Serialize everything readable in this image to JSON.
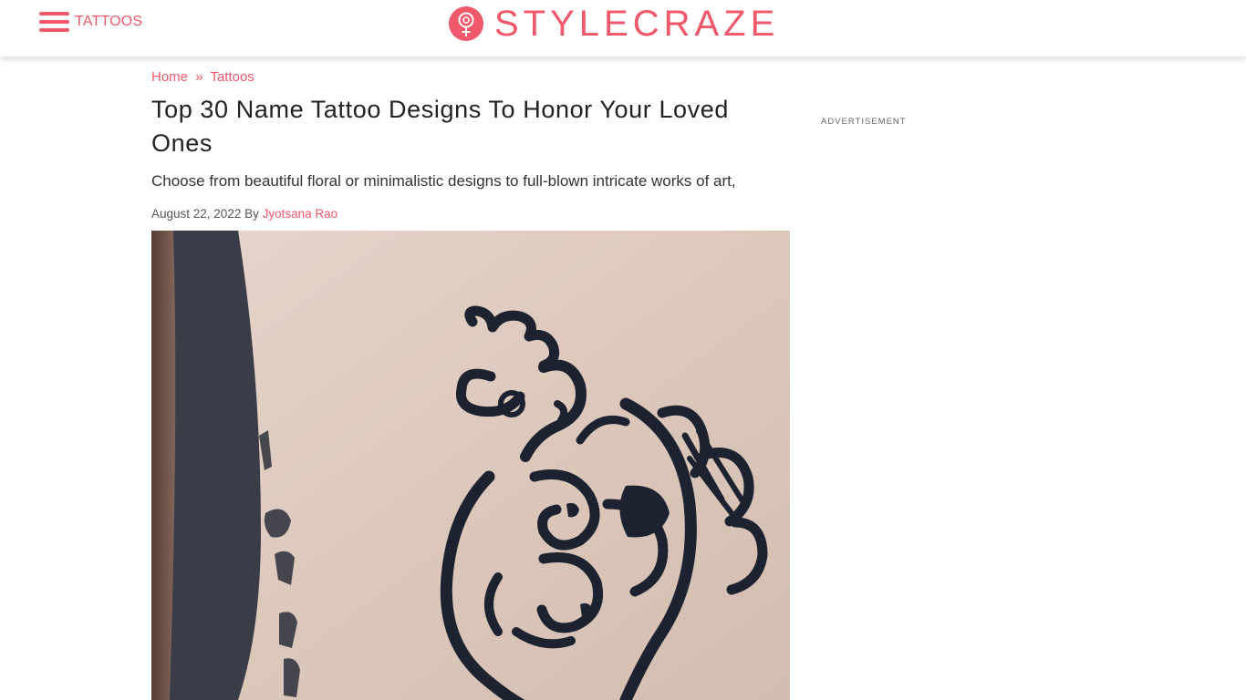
{
  "header": {
    "menu_label": "TATTOOS",
    "logo_text": "STYLECRAZE",
    "brand_color": "#f0586b"
  },
  "breadcrumb": {
    "home": "Home",
    "separator": "»",
    "category": "Tattoos"
  },
  "article": {
    "title": "Top 30 Name Tattoo Designs To Honor Your Loved Ones",
    "subtitle": "Choose from beautiful floral or minimalistic designs to full-blown intricate works of art,",
    "date": "August 22, 2022",
    "by": "By",
    "author": "Jyotsana Rao"
  },
  "sidebar": {
    "ad_label": "ADVERTISEMENT"
  },
  "icons": {
    "menu": "hamburger-menu-icon",
    "logo": "female-symbol-logo-icon"
  }
}
